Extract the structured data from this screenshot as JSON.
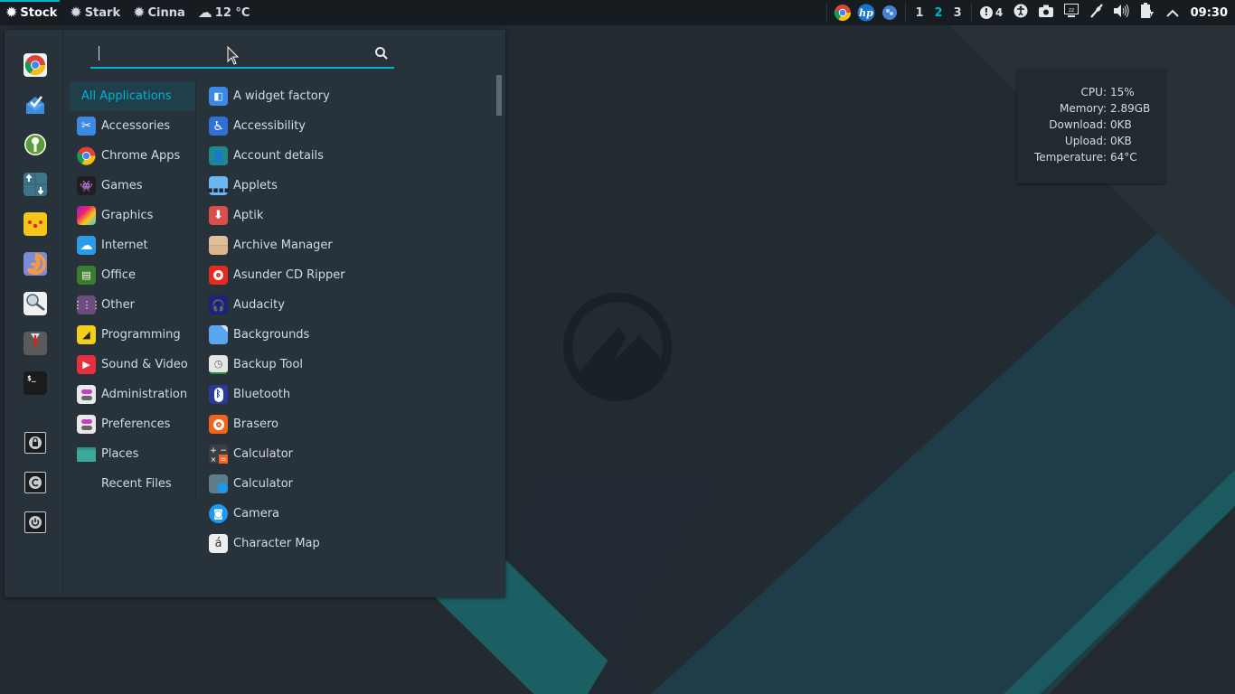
{
  "panel": {
    "apps": [
      {
        "label": "Stock",
        "icon": "gear-icon",
        "active": true
      },
      {
        "label": "Stark",
        "icon": "gear-icon",
        "active": false
      },
      {
        "label": "Cinna",
        "icon": "gear-icon",
        "active": false
      }
    ],
    "weather": {
      "label": "12 °C",
      "icon": "weather-cloud-sun-icon"
    },
    "tray_launchers": [
      "chrome-icon",
      "hp-icon",
      "globe-icon"
    ],
    "workspaces": [
      {
        "label": "1",
        "active": false
      },
      {
        "label": "2",
        "active": true
      },
      {
        "label": "3",
        "active": false
      }
    ],
    "notifications": {
      "count": "4",
      "icon": "alert-icon"
    },
    "indicators": [
      "accessibility-icon",
      "camera-icon",
      "display-sleep-icon",
      "network-wired-icon",
      "volume-icon",
      "battery-charging-icon",
      "chevron-up-icon"
    ],
    "clock": "09:30"
  },
  "menu": {
    "search": {
      "value": "",
      "placeholder": ""
    },
    "favorites": [
      "google-chrome",
      "inbox-mail",
      "keepassx-key",
      "transfer-updown",
      "yellow-app",
      "sphere-swirl",
      "search-document",
      "suit-tie",
      "terminal"
    ],
    "system_buttons": [
      "lock-screen",
      "logout",
      "shutdown"
    ],
    "categories": [
      {
        "label": "All Applications",
        "icon": "",
        "color": "",
        "selected": true
      },
      {
        "label": "Accessories",
        "icon": "scissors-icon",
        "color": "#3d8ae6"
      },
      {
        "label": "Chrome Apps",
        "icon": "chrome-icon",
        "color": ""
      },
      {
        "label": "Games",
        "icon": "space-invader-icon",
        "color": "#1d1f21"
      },
      {
        "label": "Graphics",
        "icon": "rainbow-icon",
        "color": ""
      },
      {
        "label": "Internet",
        "icon": "cloud-icon",
        "color": "#2a9be8"
      },
      {
        "label": "Office",
        "icon": "document-icon",
        "color": "#3c7c2e"
      },
      {
        "label": "Other",
        "icon": "grid-icon",
        "color": "#6d4b7c"
      },
      {
        "label": "Programming",
        "icon": "ruler-icon",
        "color": "#f2cf1a"
      },
      {
        "label": "Sound & Video",
        "icon": "play-icon",
        "color": "#e6303c"
      },
      {
        "label": "Administration",
        "icon": "toggles-icon",
        "color": "#e9e9ec"
      },
      {
        "label": "Preferences",
        "icon": "toggles-icon",
        "color": "#e9e9ec"
      },
      {
        "label": "Places",
        "icon": "folder-icon",
        "color": "#3aa89a"
      },
      {
        "label": "Recent Files",
        "icon": "",
        "color": ""
      }
    ],
    "applications": [
      {
        "label": "A widget factory",
        "icon": "widget-factory-icon",
        "color": "#3c89e5"
      },
      {
        "label": "Accessibility",
        "icon": "accessibility-icon",
        "color": "#2f6fd6"
      },
      {
        "label": "Account details",
        "icon": "user-icon",
        "color": "#1e8a8e"
      },
      {
        "label": "Applets",
        "icon": "applets-icon",
        "color": "#6bb8f0"
      },
      {
        "label": "Aptik",
        "icon": "download-arrow-icon",
        "color": "#d9504a"
      },
      {
        "label": "Archive Manager",
        "icon": "archive-box-icon",
        "color": "#d9b48f"
      },
      {
        "label": "Asunder CD Ripper",
        "icon": "cd-icon",
        "color": "#e62b1e"
      },
      {
        "label": "Audacity",
        "icon": "headphones-icon",
        "color": "#1a237e"
      },
      {
        "label": "Backgrounds",
        "icon": "wallpaper-icon",
        "color": "#59a8ef"
      },
      {
        "label": "Backup Tool",
        "icon": "backup-clock-icon",
        "color": "#e5e5e5"
      },
      {
        "label": "Bluetooth",
        "icon": "bluetooth-icon",
        "color": "#2a3a9c"
      },
      {
        "label": "Brasero",
        "icon": "disc-burn-icon",
        "color": "#f0641e"
      },
      {
        "label": "Calculator",
        "icon": "calculator-icon",
        "color": "#3b3f44"
      },
      {
        "label": "Calculator",
        "icon": "calculator-alt-icon",
        "color": "#5e7d8c"
      },
      {
        "label": "Camera",
        "icon": "camera-icon",
        "color": "#1a9af0"
      },
      {
        "label": "Character Map",
        "icon": "character-map-icon",
        "color": "#eeeeee"
      }
    ],
    "scroll_position": 0
  },
  "conky": {
    "rows": [
      {
        "key": "CPU:",
        "value": "15%"
      },
      {
        "key": "Memory:",
        "value": "2.89GB"
      },
      {
        "key": "Download:",
        "value": "0KB"
      },
      {
        "key": "Upload:",
        "value": "0KB"
      },
      {
        "key": "Temperature:",
        "value": "64°C"
      }
    ]
  }
}
